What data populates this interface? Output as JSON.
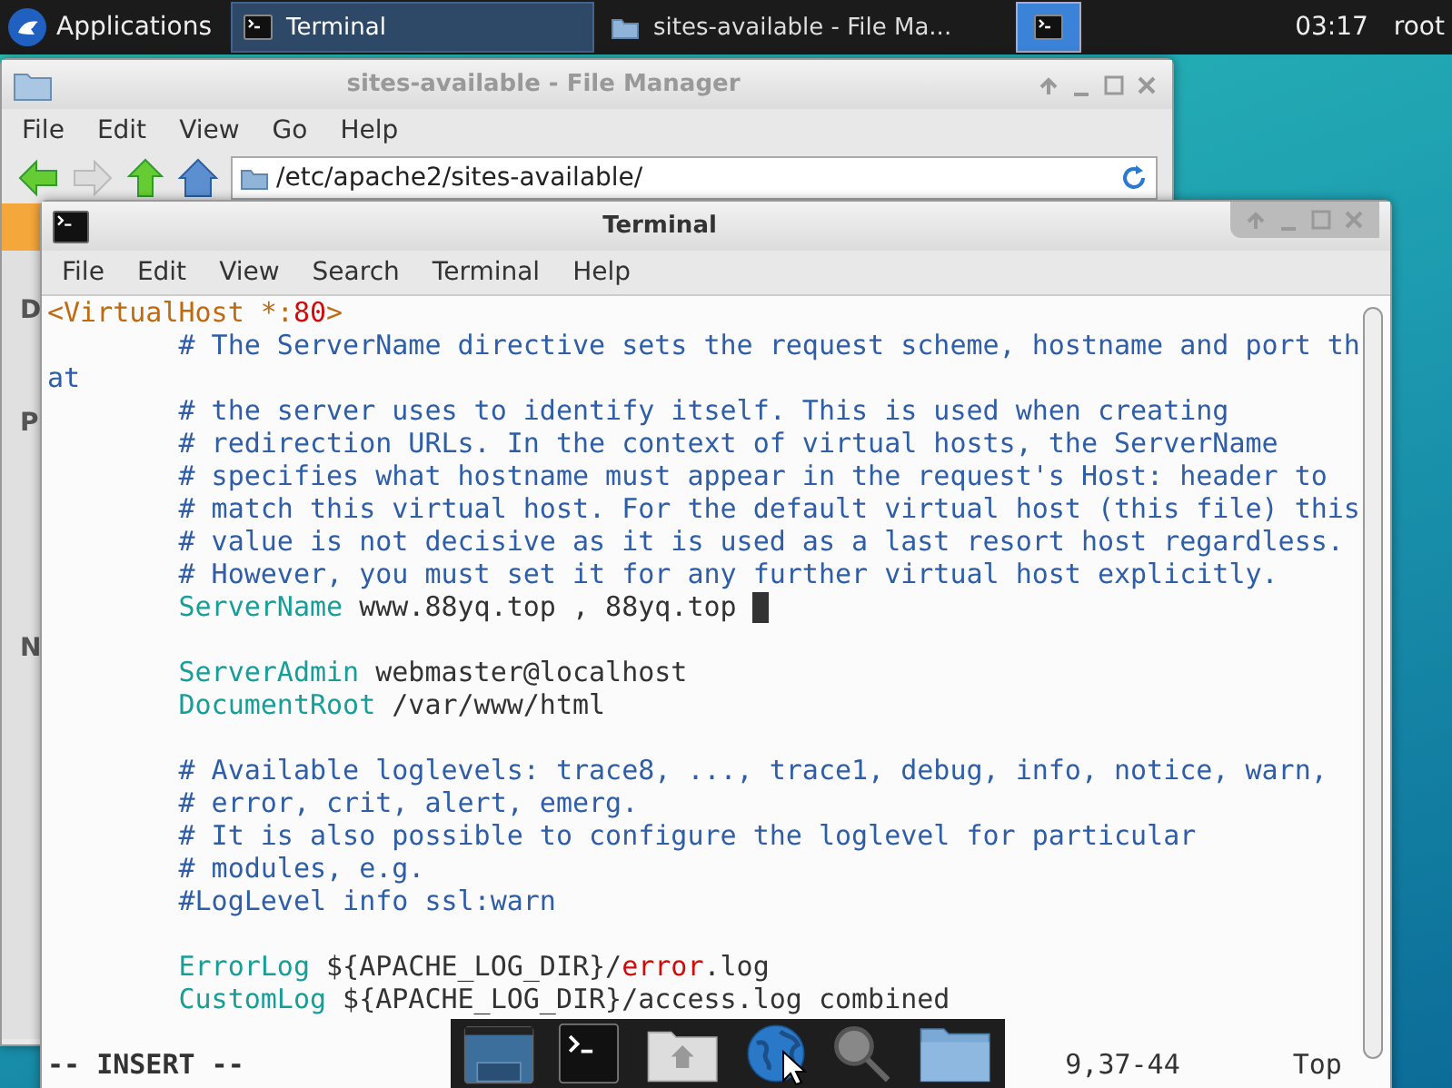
{
  "panel": {
    "apps_menu": "Applications",
    "tasks": [
      {
        "label": "Terminal",
        "kind": "terminal",
        "selected": true
      },
      {
        "label": "sites-available - File Ma...",
        "kind": "folder",
        "selected": false
      }
    ],
    "clock": "03:17",
    "user": "root"
  },
  "file_manager": {
    "title": "sites-available - File Manager",
    "menu": [
      "File",
      "Edit",
      "View",
      "Go",
      "Help"
    ],
    "location": "/etc/apache2/sites-available/",
    "sidebar_fragments": [
      "D",
      "P",
      "N"
    ]
  },
  "terminal": {
    "title": "Terminal",
    "menu": [
      "File",
      "Edit",
      "View",
      "Search",
      "Terminal",
      "Help"
    ],
    "lines": [
      {
        "kind": "text",
        "segments": [
          {
            "kind": "tag",
            "text": "<VirtualHost *:"
          },
          {
            "kind": "number",
            "text": "80"
          },
          {
            "kind": "tag",
            "text": ">"
          }
        ]
      },
      {
        "kind": "text",
        "segments": [
          {
            "kind": "comment",
            "text": "        # The ServerName directive sets the request scheme, hostname and port th"
          }
        ]
      },
      {
        "kind": "text",
        "segments": [
          {
            "kind": "comment",
            "text": "at"
          }
        ]
      },
      {
        "kind": "text",
        "segments": [
          {
            "kind": "comment",
            "text": "        # the server uses to identify itself. This is used when creating"
          }
        ]
      },
      {
        "kind": "text",
        "segments": [
          {
            "kind": "comment",
            "text": "        # redirection URLs. In the context of virtual hosts, the ServerName"
          }
        ]
      },
      {
        "kind": "text",
        "segments": [
          {
            "kind": "comment",
            "text": "        # specifies what hostname must appear in the request's Host: header to"
          }
        ]
      },
      {
        "kind": "text",
        "segments": [
          {
            "kind": "comment",
            "text": "        # match this virtual host. For the default virtual host (this file) this"
          }
        ]
      },
      {
        "kind": "text",
        "segments": [
          {
            "kind": "comment",
            "text": "        # value is not decisive as it is used as a last resort host regardless."
          }
        ]
      },
      {
        "kind": "text",
        "segments": [
          {
            "kind": "comment",
            "text": "        # However, you must set it for any further virtual host explicitly."
          }
        ]
      },
      {
        "kind": "text",
        "cursor": true,
        "segments": [
          {
            "kind": "keyword",
            "text": "        ServerName"
          },
          {
            "kind": "plain",
            "text": " www.88yq.top , 88yq.top "
          }
        ]
      },
      {
        "kind": "blank"
      },
      {
        "kind": "text",
        "segments": [
          {
            "kind": "keyword",
            "text": "        ServerAdmin"
          },
          {
            "kind": "plain",
            "text": " webmaster@localhost"
          }
        ]
      },
      {
        "kind": "text",
        "segments": [
          {
            "kind": "keyword",
            "text": "        DocumentRoot"
          },
          {
            "kind": "plain",
            "text": " /var/www/html"
          }
        ]
      },
      {
        "kind": "blank"
      },
      {
        "kind": "text",
        "segments": [
          {
            "kind": "comment",
            "text": "        # Available loglevels: trace8, ..., trace1, debug, info, notice, warn,"
          }
        ]
      },
      {
        "kind": "text",
        "segments": [
          {
            "kind": "comment",
            "text": "        # error, crit, alert, emerg."
          }
        ]
      },
      {
        "kind": "text",
        "segments": [
          {
            "kind": "comment",
            "text": "        # It is also possible to configure the loglevel for particular"
          }
        ]
      },
      {
        "kind": "text",
        "segments": [
          {
            "kind": "comment",
            "text": "        # modules, e.g."
          }
        ]
      },
      {
        "kind": "text",
        "segments": [
          {
            "kind": "comment",
            "text": "        #LogLevel info ssl:warn"
          }
        ]
      },
      {
        "kind": "blank"
      },
      {
        "kind": "text",
        "segments": [
          {
            "kind": "keyword",
            "text": "        ErrorLog"
          },
          {
            "kind": "plain",
            "text": " ${APACHE_LOG_DIR}/"
          },
          {
            "kind": "number",
            "text": "error"
          },
          {
            "kind": "plain",
            "text": ".log"
          }
        ]
      },
      {
        "kind": "text",
        "segments": [
          {
            "kind": "keyword",
            "text": "        CustomLog"
          },
          {
            "kind": "plain",
            "text": " ${APACHE_LOG_DIR}/access.log combined"
          }
        ]
      },
      {
        "kind": "blank"
      }
    ],
    "status": {
      "mode": "-- INSERT --",
      "position": "9,37-44",
      "scroll": "Top"
    }
  },
  "dock": [
    {
      "kind": "desktop"
    },
    {
      "kind": "terminal"
    },
    {
      "kind": "home"
    },
    {
      "kind": "browser"
    },
    {
      "kind": "search"
    },
    {
      "kind": "folder"
    }
  ]
}
